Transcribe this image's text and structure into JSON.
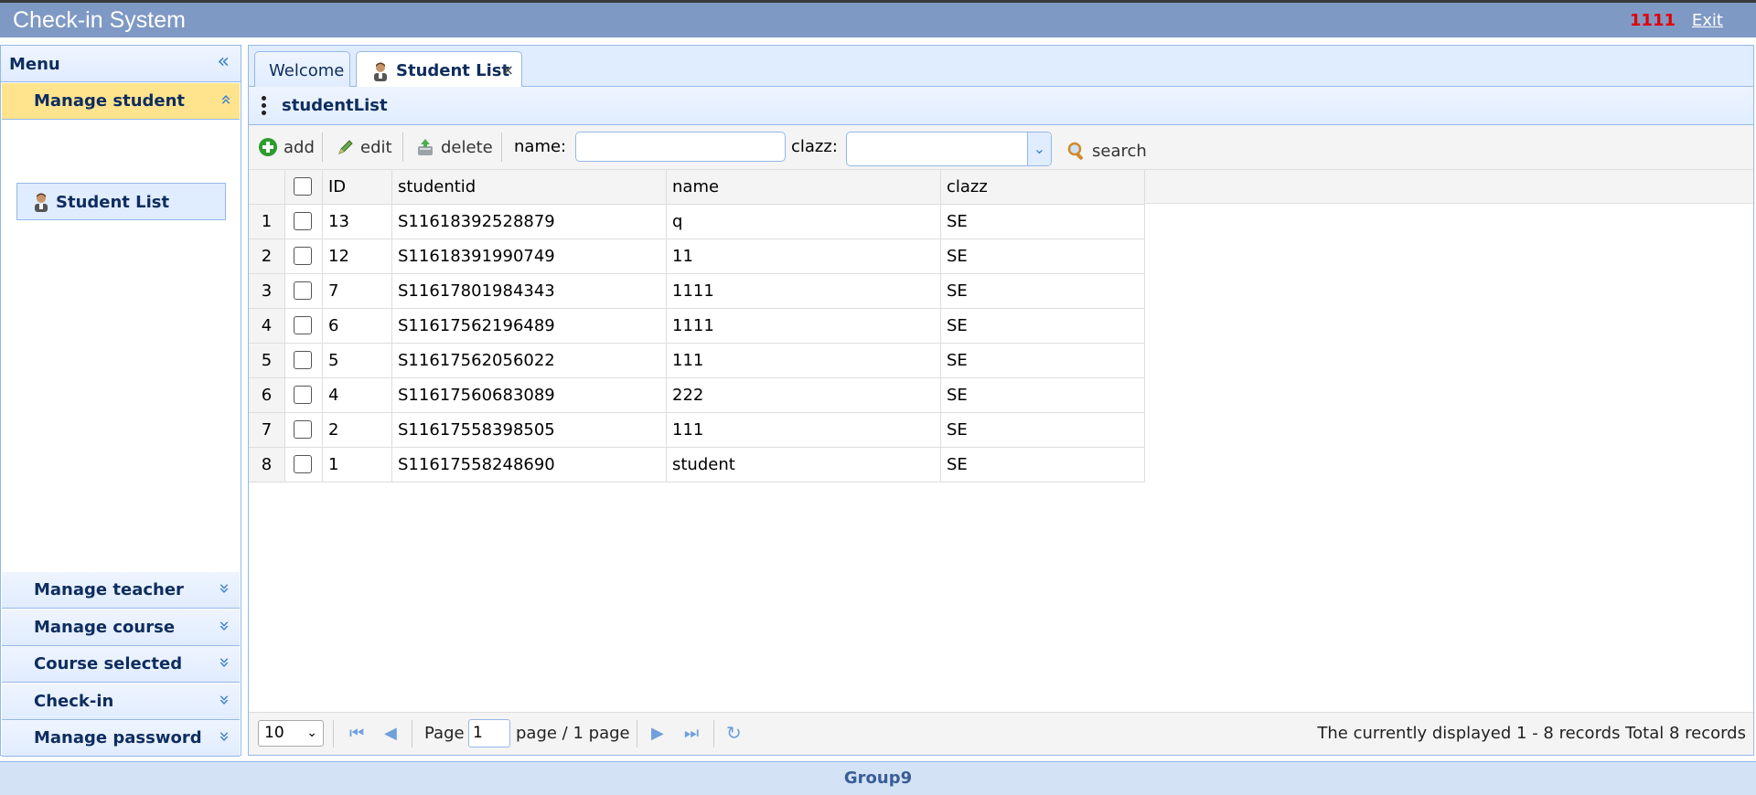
{
  "header": {
    "title": "Check-in System",
    "user": "1111",
    "exit": "Exit"
  },
  "sidebar": {
    "title": "Menu",
    "active_group": "Manage student",
    "tree_item": "Student List",
    "groups": [
      "Manage teacher",
      "Manage course",
      "Course selected",
      "Check-in",
      "Manage password"
    ]
  },
  "tabs": [
    {
      "label": "Welcome"
    },
    {
      "label": "Student List"
    }
  ],
  "panel": {
    "title": "studentList"
  },
  "toolbar": {
    "add": "add",
    "edit": "edit",
    "delete": "delete",
    "name_label": "name:",
    "name_value": "",
    "clazz_label": "clazz:",
    "clazz_value": "",
    "search": "search"
  },
  "grid": {
    "columns": [
      "ID",
      "studentid",
      "name",
      "clazz"
    ],
    "rows": [
      {
        "num": "1",
        "id": "13",
        "studentid": "S11618392528879",
        "name": "q",
        "clazz": "SE"
      },
      {
        "num": "2",
        "id": "12",
        "studentid": "S11618391990749",
        "name": "11",
        "clazz": "SE"
      },
      {
        "num": "3",
        "id": "7",
        "studentid": "S11617801984343",
        "name": "1111",
        "clazz": "SE"
      },
      {
        "num": "4",
        "id": "6",
        "studentid": "S11617562196489",
        "name": "1111",
        "clazz": "SE"
      },
      {
        "num": "5",
        "id": "5",
        "studentid": "S11617562056022",
        "name": "111",
        "clazz": "SE"
      },
      {
        "num": "6",
        "id": "4",
        "studentid": "S11617560683089",
        "name": "222",
        "clazz": "SE"
      },
      {
        "num": "7",
        "id": "2",
        "studentid": "S11617558398505",
        "name": "111",
        "clazz": "SE"
      },
      {
        "num": "8",
        "id": "1",
        "studentid": "S11617558248690",
        "name": "student",
        "clazz": "SE"
      }
    ]
  },
  "pager": {
    "page_size": "10",
    "page_label": "Page",
    "page_value": "1",
    "page_suffix": "page / 1 page",
    "info": "The currently displayed 1 - 8 records Total 8 records"
  },
  "footer": {
    "text": "Group9"
  }
}
